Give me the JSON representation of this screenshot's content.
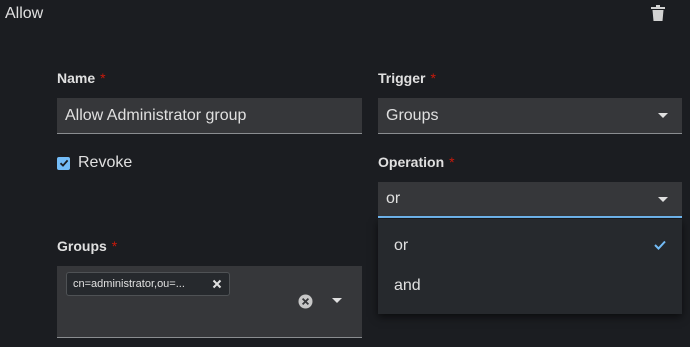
{
  "rule": {
    "title": "Allow"
  },
  "icons": {
    "delete": "trash-icon",
    "clear": "times-circle-icon",
    "caret": "caret-down-icon",
    "check": "check-icon",
    "remove_chip": "times-icon"
  },
  "name_field": {
    "label": "Name",
    "required": "*",
    "value": "Allow Administrator group"
  },
  "trigger": {
    "label": "Trigger",
    "required": "*",
    "value": "Groups"
  },
  "revoke": {
    "label": "Revoke",
    "checked": true
  },
  "operation": {
    "label": "Operation",
    "required": "*",
    "value": "or",
    "options": [
      {
        "label": "or",
        "selected": true
      },
      {
        "label": "and",
        "selected": false
      }
    ]
  },
  "groups": {
    "label": "Groups",
    "required": "*",
    "chips": [
      {
        "text": "cn=administrator,ou=..."
      }
    ]
  },
  "colors": {
    "background": "#1b1d21",
    "input": "#36373a",
    "accent": "#73bcf7",
    "required": "#c9190b"
  }
}
